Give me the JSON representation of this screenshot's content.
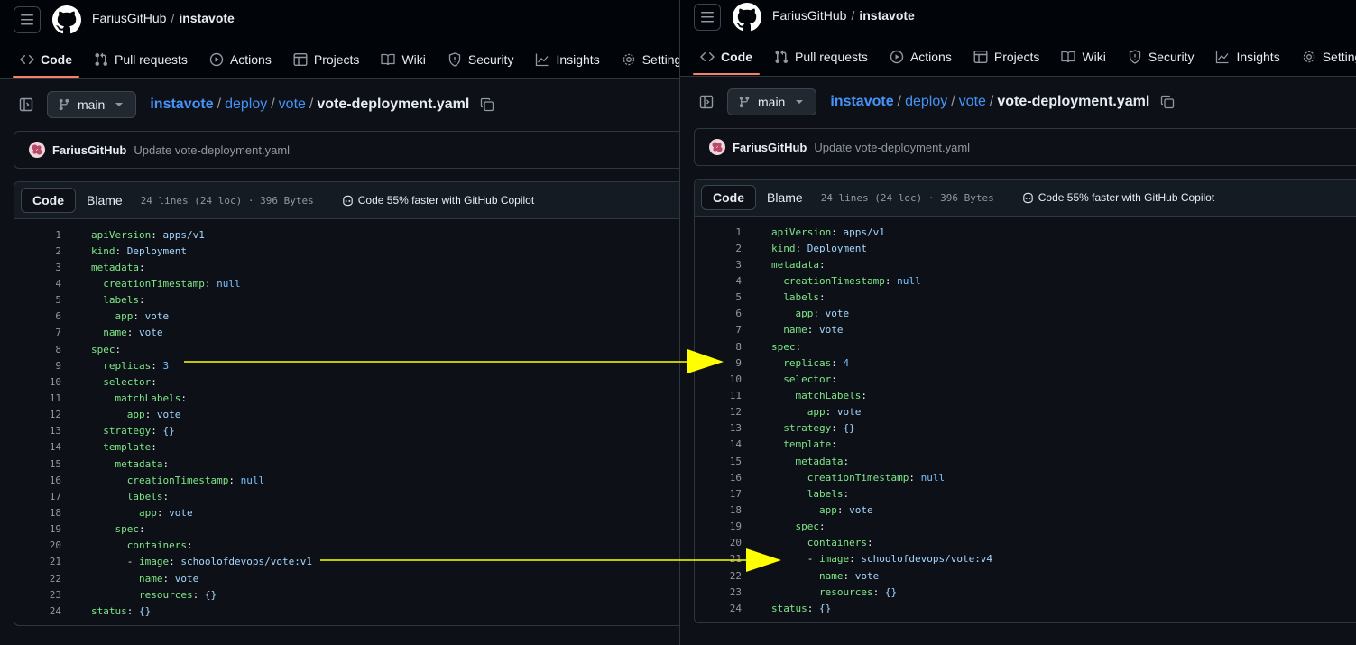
{
  "header": {
    "owner": "FariusGitHub",
    "separator": "/",
    "repo": "instavote"
  },
  "tabs": [
    {
      "label": "Code",
      "icon": "code-icon",
      "active": true
    },
    {
      "label": "Pull requests",
      "icon": "git-pull-request-icon"
    },
    {
      "label": "Actions",
      "icon": "play-icon"
    },
    {
      "label": "Projects",
      "icon": "table-icon"
    },
    {
      "label": "Wiki",
      "icon": "book-icon"
    },
    {
      "label": "Security",
      "icon": "shield-icon"
    },
    {
      "label": "Insights",
      "icon": "graph-icon"
    },
    {
      "label": "Settings",
      "icon": "gear-icon"
    }
  ],
  "branch": {
    "label": "main"
  },
  "path": {
    "segments": [
      "instavote",
      "deploy",
      "vote"
    ],
    "separator": "/",
    "file": "vote-deployment.yaml"
  },
  "commit": {
    "author": "FariusGitHub",
    "message": "Update vote-deployment.yaml"
  },
  "viewer": {
    "code_tab": "Code",
    "blame_tab": "Blame",
    "meta": "24 lines (24 loc) · 396 Bytes",
    "copilot": "Code 55% faster with GitHub Copilot"
  },
  "files": [
    {
      "lines": [
        [
          {
            "t": "apiVersion",
            "c": "k"
          },
          {
            "t": ": ",
            "c": "p"
          },
          {
            "t": "apps/v1",
            "c": "v"
          }
        ],
        [
          {
            "t": "kind",
            "c": "k"
          },
          {
            "t": ": ",
            "c": "p"
          },
          {
            "t": "Deployment",
            "c": "v"
          }
        ],
        [
          {
            "t": "metadata",
            "c": "k"
          },
          {
            "t": ":",
            "c": "p"
          }
        ],
        [
          {
            "t": "  creationTimestamp",
            "c": "k"
          },
          {
            "t": ": ",
            "c": "p"
          },
          {
            "t": "null",
            "c": "n"
          }
        ],
        [
          {
            "t": "  labels",
            "c": "k"
          },
          {
            "t": ":",
            "c": "p"
          }
        ],
        [
          {
            "t": "    app",
            "c": "k"
          },
          {
            "t": ": ",
            "c": "p"
          },
          {
            "t": "vote",
            "c": "v"
          }
        ],
        [
          {
            "t": "  name",
            "c": "k"
          },
          {
            "t": ": ",
            "c": "p"
          },
          {
            "t": "vote",
            "c": "v"
          }
        ],
        [
          {
            "t": "spec",
            "c": "k"
          },
          {
            "t": ":",
            "c": "p"
          }
        ],
        [
          {
            "t": "  replicas",
            "c": "k"
          },
          {
            "t": ": ",
            "c": "p"
          },
          {
            "t": "3",
            "c": "n"
          }
        ],
        [
          {
            "t": "  selector",
            "c": "k"
          },
          {
            "t": ":",
            "c": "p"
          }
        ],
        [
          {
            "t": "    matchLabels",
            "c": "k"
          },
          {
            "t": ":",
            "c": "p"
          }
        ],
        [
          {
            "t": "      app",
            "c": "k"
          },
          {
            "t": ": ",
            "c": "p"
          },
          {
            "t": "vote",
            "c": "v"
          }
        ],
        [
          {
            "t": "  strategy",
            "c": "k"
          },
          {
            "t": ": ",
            "c": "p"
          },
          {
            "t": "{}",
            "c": "v"
          }
        ],
        [
          {
            "t": "  template",
            "c": "k"
          },
          {
            "t": ":",
            "c": "p"
          }
        ],
        [
          {
            "t": "    metadata",
            "c": "k"
          },
          {
            "t": ":",
            "c": "p"
          }
        ],
        [
          {
            "t": "      creationTimestamp",
            "c": "k"
          },
          {
            "t": ": ",
            "c": "p"
          },
          {
            "t": "null",
            "c": "n"
          }
        ],
        [
          {
            "t": "      labels",
            "c": "k"
          },
          {
            "t": ":",
            "c": "p"
          }
        ],
        [
          {
            "t": "        app",
            "c": "k"
          },
          {
            "t": ": ",
            "c": "p"
          },
          {
            "t": "vote",
            "c": "v"
          }
        ],
        [
          {
            "t": "    spec",
            "c": "k"
          },
          {
            "t": ":",
            "c": "p"
          }
        ],
        [
          {
            "t": "      containers",
            "c": "k"
          },
          {
            "t": ":",
            "c": "p"
          }
        ],
        [
          {
            "t": "      - ",
            "c": "p"
          },
          {
            "t": "image",
            "c": "k"
          },
          {
            "t": ": ",
            "c": "p"
          },
          {
            "t": "schoolofdevops/vote:v1",
            "c": "v"
          }
        ],
        [
          {
            "t": "        name",
            "c": "k"
          },
          {
            "t": ": ",
            "c": "p"
          },
          {
            "t": "vote",
            "c": "v"
          }
        ],
        [
          {
            "t": "        resources",
            "c": "k"
          },
          {
            "t": ": ",
            "c": "p"
          },
          {
            "t": "{}",
            "c": "v"
          }
        ],
        [
          {
            "t": "status",
            "c": "k"
          },
          {
            "t": ": ",
            "c": "p"
          },
          {
            "t": "{}",
            "c": "v"
          }
        ]
      ]
    },
    {
      "lines": [
        [
          {
            "t": "apiVersion",
            "c": "k"
          },
          {
            "t": ": ",
            "c": "p"
          },
          {
            "t": "apps/v1",
            "c": "v"
          }
        ],
        [
          {
            "t": "kind",
            "c": "k"
          },
          {
            "t": ": ",
            "c": "p"
          },
          {
            "t": "Deployment",
            "c": "v"
          }
        ],
        [
          {
            "t": "metadata",
            "c": "k"
          },
          {
            "t": ":",
            "c": "p"
          }
        ],
        [
          {
            "t": "  creationTimestamp",
            "c": "k"
          },
          {
            "t": ": ",
            "c": "p"
          },
          {
            "t": "null",
            "c": "n"
          }
        ],
        [
          {
            "t": "  labels",
            "c": "k"
          },
          {
            "t": ":",
            "c": "p"
          }
        ],
        [
          {
            "t": "    app",
            "c": "k"
          },
          {
            "t": ": ",
            "c": "p"
          },
          {
            "t": "vote",
            "c": "v"
          }
        ],
        [
          {
            "t": "  name",
            "c": "k"
          },
          {
            "t": ": ",
            "c": "p"
          },
          {
            "t": "vote",
            "c": "v"
          }
        ],
        [
          {
            "t": "spec",
            "c": "k"
          },
          {
            "t": ":",
            "c": "p"
          }
        ],
        [
          {
            "t": "  replicas",
            "c": "k"
          },
          {
            "t": ": ",
            "c": "p"
          },
          {
            "t": "4",
            "c": "n"
          }
        ],
        [
          {
            "t": "  selector",
            "c": "k"
          },
          {
            "t": ":",
            "c": "p"
          }
        ],
        [
          {
            "t": "    matchLabels",
            "c": "k"
          },
          {
            "t": ":",
            "c": "p"
          }
        ],
        [
          {
            "t": "      app",
            "c": "k"
          },
          {
            "t": ": ",
            "c": "p"
          },
          {
            "t": "vote",
            "c": "v"
          }
        ],
        [
          {
            "t": "  strategy",
            "c": "k"
          },
          {
            "t": ": ",
            "c": "p"
          },
          {
            "t": "{}",
            "c": "v"
          }
        ],
        [
          {
            "t": "  template",
            "c": "k"
          },
          {
            "t": ":",
            "c": "p"
          }
        ],
        [
          {
            "t": "    metadata",
            "c": "k"
          },
          {
            "t": ":",
            "c": "p"
          }
        ],
        [
          {
            "t": "      creationTimestamp",
            "c": "k"
          },
          {
            "t": ": ",
            "c": "p"
          },
          {
            "t": "null",
            "c": "n"
          }
        ],
        [
          {
            "t": "      labels",
            "c": "k"
          },
          {
            "t": ":",
            "c": "p"
          }
        ],
        [
          {
            "t": "        app",
            "c": "k"
          },
          {
            "t": ": ",
            "c": "p"
          },
          {
            "t": "vote",
            "c": "v"
          }
        ],
        [
          {
            "t": "    spec",
            "c": "k"
          },
          {
            "t": ":",
            "c": "p"
          }
        ],
        [
          {
            "t": "      containers",
            "c": "k"
          },
          {
            "t": ":",
            "c": "p"
          }
        ],
        [
          {
            "t": "      - ",
            "c": "p"
          },
          {
            "t": "image",
            "c": "k"
          },
          {
            "t": ": ",
            "c": "p"
          },
          {
            "t": "schoolofdevops/vote:v4",
            "c": "v"
          }
        ],
        [
          {
            "t": "        name",
            "c": "k"
          },
          {
            "t": ": ",
            "c": "p"
          },
          {
            "t": "vote",
            "c": "v"
          }
        ],
        [
          {
            "t": "        resources",
            "c": "k"
          },
          {
            "t": ": ",
            "c": "p"
          },
          {
            "t": "{}",
            "c": "v"
          }
        ],
        [
          {
            "t": "status",
            "c": "k"
          },
          {
            "t": ": ",
            "c": "p"
          },
          {
            "t": "{}",
            "c": "v"
          }
        ]
      ]
    }
  ],
  "annotation": {
    "arrow_color": "#ffff00"
  },
  "colors": {
    "accent": "#f78166",
    "link": "#4493f8",
    "bg": "#0d1117"
  }
}
